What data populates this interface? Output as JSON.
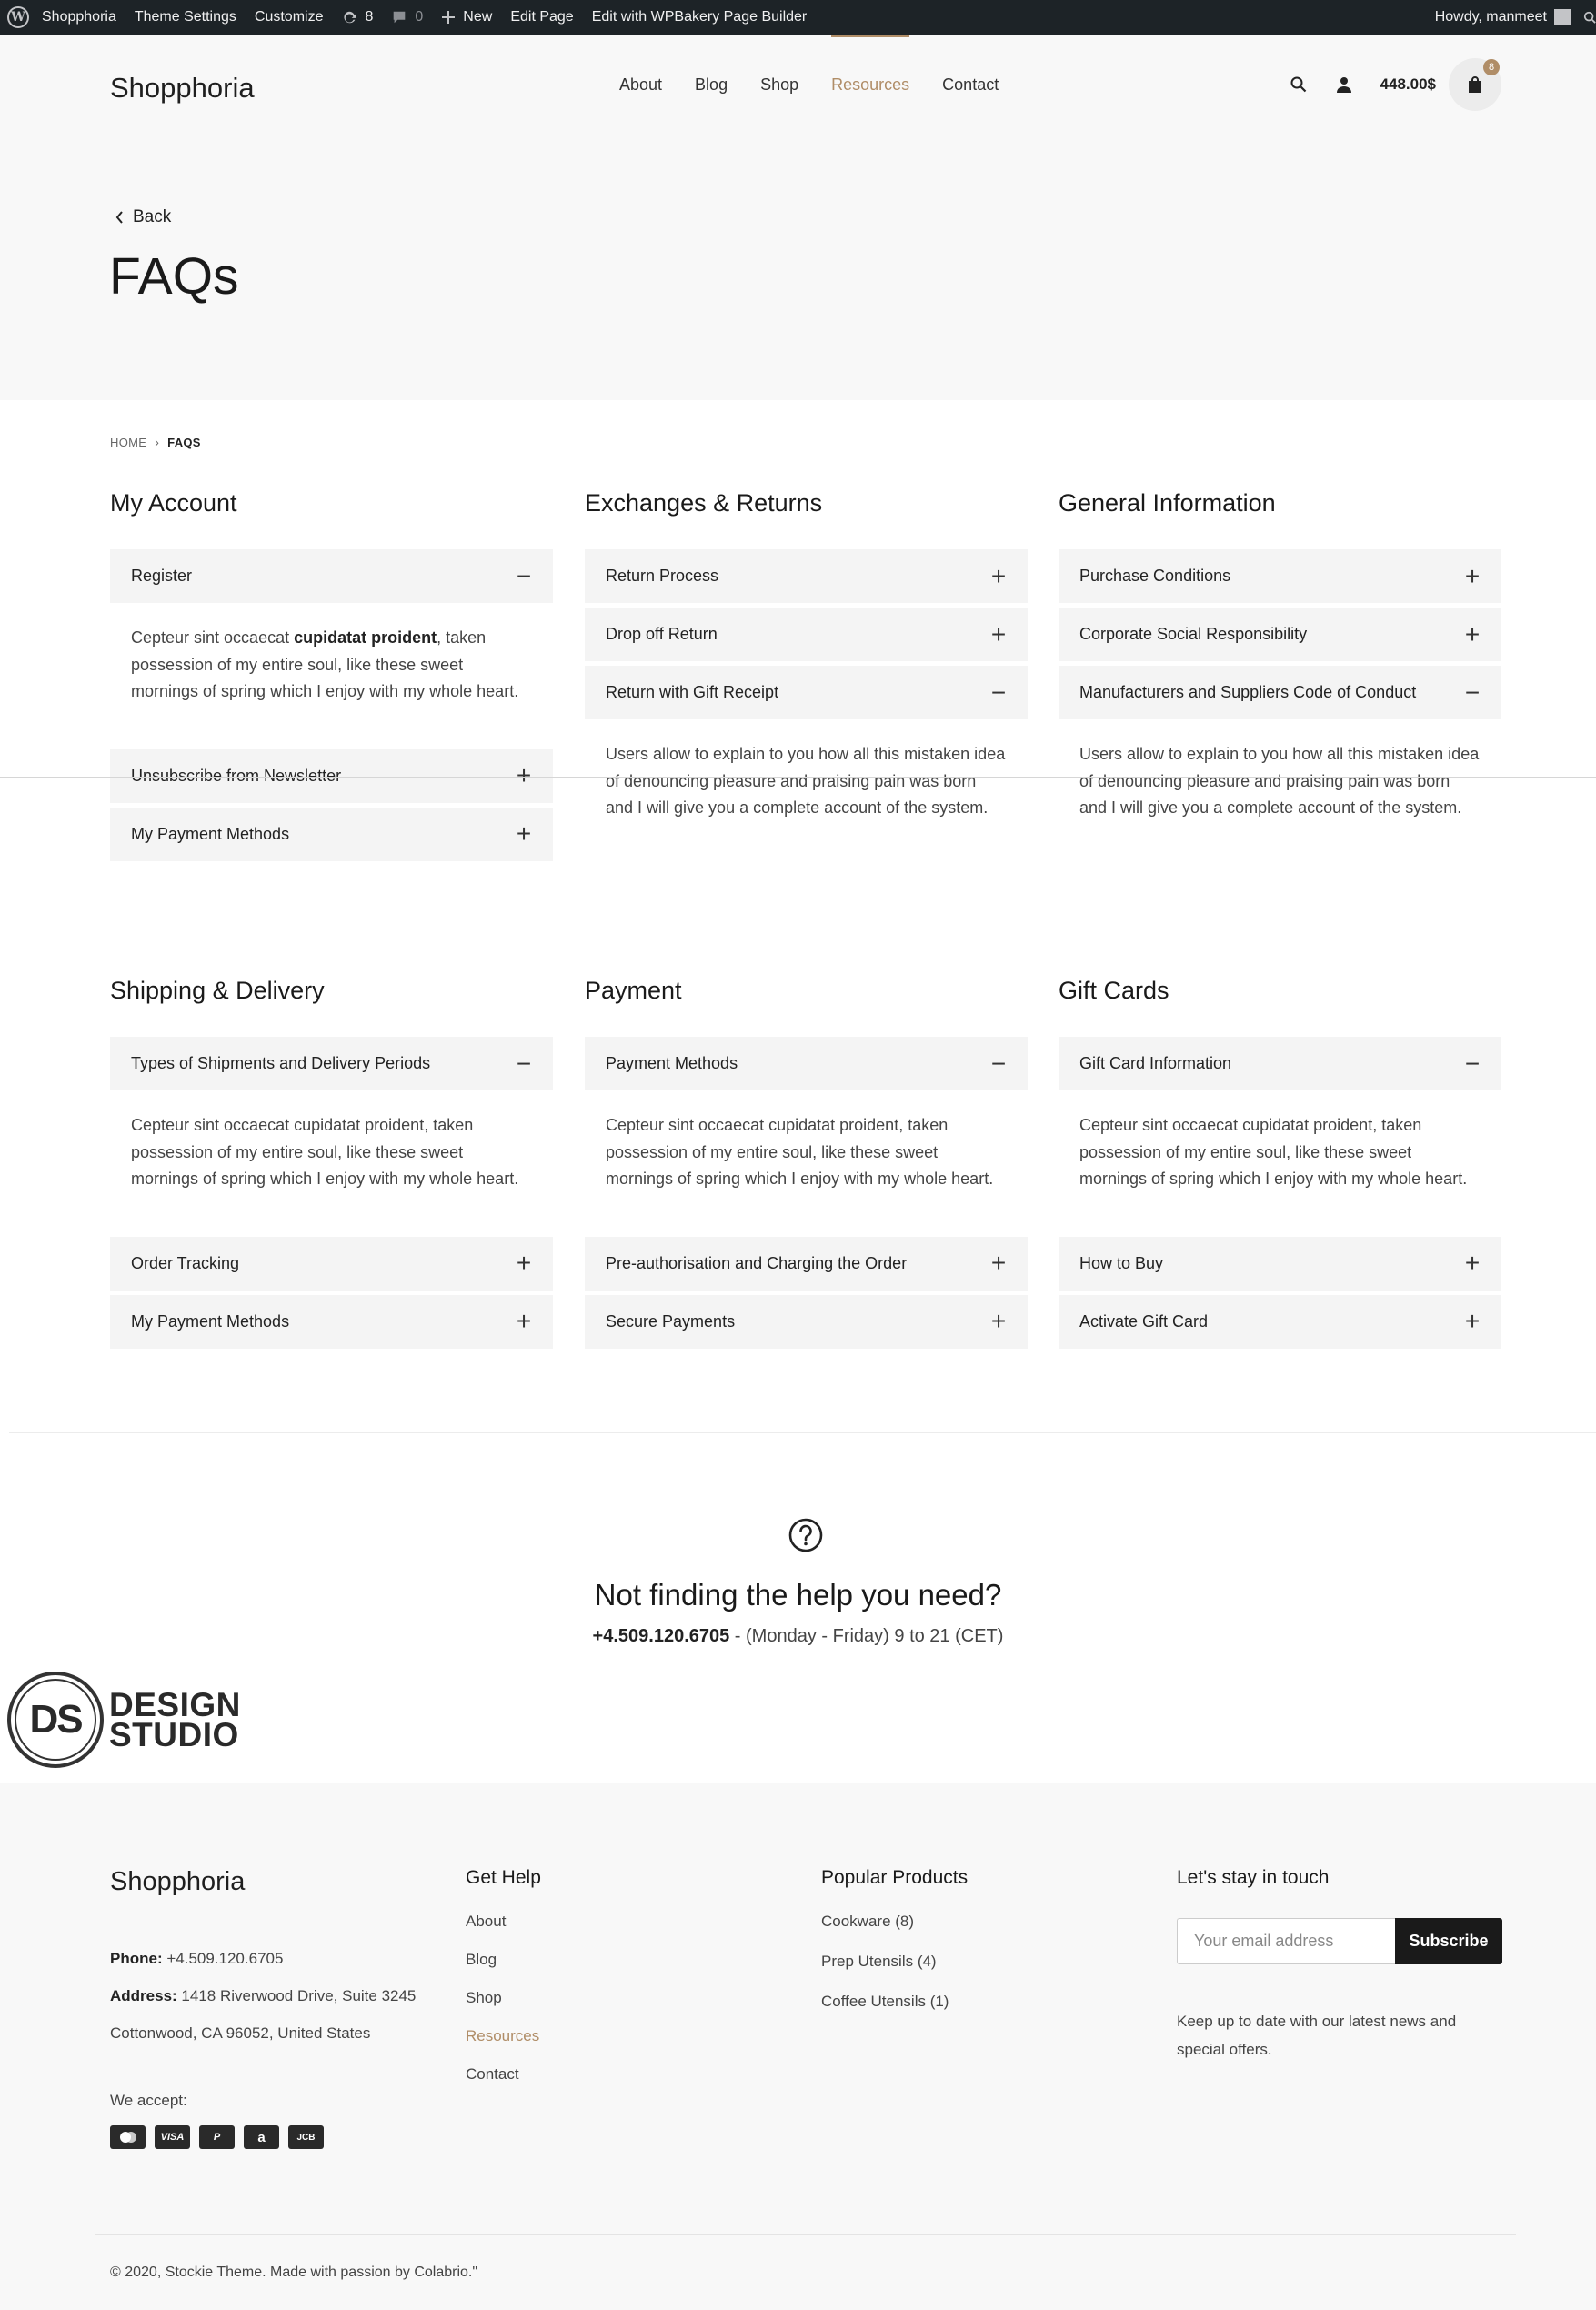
{
  "adminbar": {
    "site": "Shopphoria",
    "theme_settings": "Theme Settings",
    "customize": "Customize",
    "updates_count": "8",
    "comments_count": "0",
    "new": "New",
    "edit_page": "Edit Page",
    "edit_wpbakery": "Edit with WPBakery Page Builder",
    "howdy": "Howdy, manmeet"
  },
  "header": {
    "logo": "Shopphoria",
    "nav": [
      "About",
      "Blog",
      "Shop",
      "Resources",
      "Contact"
    ],
    "active_nav": "Resources",
    "cart_total": "448.00$",
    "cart_count": "8"
  },
  "page": {
    "back": "Back",
    "title": "FAQs"
  },
  "breadcrumb": {
    "home": "HOME",
    "current": "FAQS"
  },
  "faq_sections": [
    {
      "title": "My Account",
      "items": [
        {
          "q": "Register",
          "open": true,
          "answer_pre": "Cepteur sint occaecat ",
          "answer_bold": "cupidatat proident",
          "answer_post": ", taken possession of my entire soul, like these sweet mornings of spring which I enjoy with my whole heart."
        },
        {
          "q": "Unsubscribe from Newsletter",
          "open": false
        },
        {
          "q": "My Payment Methods",
          "open": false
        }
      ]
    },
    {
      "title": "Exchanges & Returns",
      "items": [
        {
          "q": "Return Process",
          "open": false
        },
        {
          "q": "Drop off Return",
          "open": false
        },
        {
          "q": "Return with Gift Receipt",
          "open": true,
          "answer": "Users allow to explain to you how all this mistaken idea of denouncing pleasure and praising pain was born and I will give you a complete account of the system."
        }
      ]
    },
    {
      "title": "General Information",
      "items": [
        {
          "q": "Purchase Conditions",
          "open": false
        },
        {
          "q": "Corporate Social Responsibility",
          "open": false
        },
        {
          "q": "Manufacturers and Suppliers Code of Conduct",
          "open": true,
          "answer": "Users allow to explain to you how all this mistaken idea of denouncing pleasure and praising pain was born and I will give you a complete account of the system."
        }
      ]
    },
    {
      "title": "Shipping & Delivery",
      "items": [
        {
          "q": "Types of Shipments and Delivery Periods",
          "open": true,
          "answer": "Cepteur sint occaecat cupidatat proident, taken possession of my entire soul, like these sweet mornings of spring which I enjoy with my whole heart."
        },
        {
          "q": "Order Tracking",
          "open": false
        },
        {
          "q": "My Payment Methods",
          "open": false
        }
      ]
    },
    {
      "title": "Payment",
      "items": [
        {
          "q": "Payment Methods",
          "open": true,
          "answer": "Cepteur sint occaecat cupidatat proident, taken possession of my entire soul, like these sweet mornings of spring which I enjoy with my whole heart."
        },
        {
          "q": "Pre-authorisation and Charging the Order",
          "open": false
        },
        {
          "q": "Secure Payments",
          "open": false
        }
      ]
    },
    {
      "title": "Gift Cards",
      "items": [
        {
          "q": "Gift Card Information",
          "open": true,
          "answer": "Cepteur sint occaecat cupidatat proident, taken possession of my entire soul, like these sweet mornings of spring which I enjoy with my whole heart."
        },
        {
          "q": "How to Buy",
          "open": false
        },
        {
          "q": "Activate Gift Card",
          "open": false
        }
      ]
    }
  ],
  "help": {
    "title": "Not finding the help you need?",
    "phone": "+4.509.120.6705",
    "hours": " - (Monday - Friday) 9 to 21 (CET)"
  },
  "stamp": {
    "mono": "DS",
    "line1": "DESIGN",
    "line2": "STUDIO"
  },
  "footer": {
    "logo": "Shopphoria",
    "phone_label": "Phone:",
    "phone": " +4.509.120.6705",
    "address_label": "Address:",
    "address1": " 1418 Riverwood Drive, Suite 3245",
    "address2": "Cottonwood, CA 96052, United States",
    "we_accept": "We accept:",
    "payment_icons": [
      "mastercard-icon",
      "visa-icon",
      "paypal-icon",
      "amazon-icon",
      "jcb-icon"
    ],
    "payment_labels": [
      "",
      "VISA",
      "P",
      "a",
      "JCB"
    ],
    "get_help_title": "Get Help",
    "get_help_links": [
      "About",
      "Blog",
      "Shop",
      "Resources",
      "Contact"
    ],
    "products_title": "Popular Products",
    "products": [
      "Cookware (8)",
      "Prep Utensils (4)",
      "Coffee Utensils (1)"
    ],
    "touch_title": "Let's stay in touch",
    "email_placeholder": "Your email address",
    "subscribe": "Subscribe",
    "newsletter_note": "Keep up to date with our latest news and special offers.",
    "copyright": "© 2020, Stockie Theme. Made with passion by Colabrio.\""
  },
  "colors": {
    "accent": "#b08d67",
    "adminbar": "#1d2327",
    "panel": "#f4f4f4",
    "header_bg": "#f8f8f8"
  }
}
